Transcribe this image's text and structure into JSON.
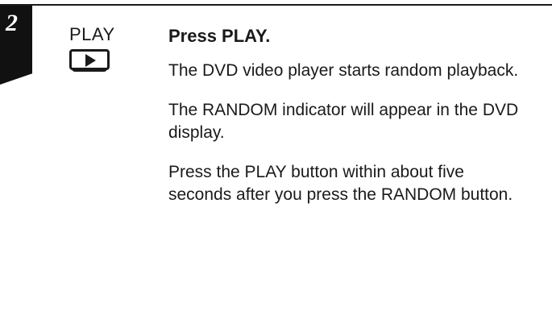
{
  "step": {
    "number": "2"
  },
  "button": {
    "label": "PLAY",
    "icon": "play-triangle-icon"
  },
  "instruction": {
    "heading": "Press PLAY.",
    "paragraphs": [
      "The DVD video player starts random playback.",
      "The RANDOM indicator will appear in the DVD display.",
      "Press the PLAY button within about five seconds after you press the RANDOM button."
    ]
  },
  "colors": {
    "ink": "#1a1a1a",
    "tab": "#111111",
    "paper": "#ffffff"
  }
}
